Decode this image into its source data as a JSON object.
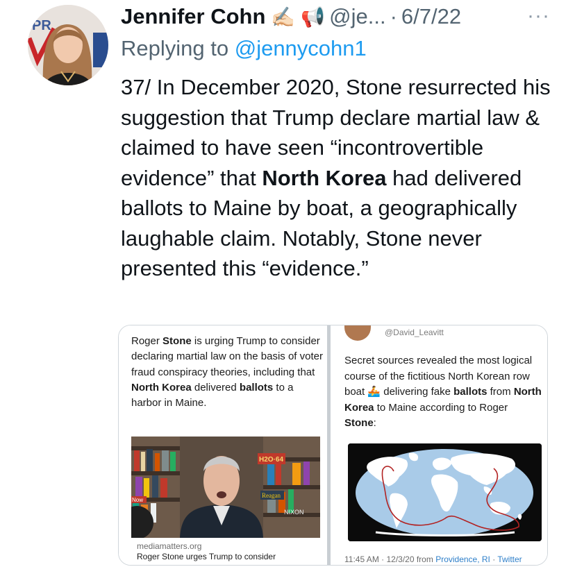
{
  "author": {
    "name": "Jennifer Cohn",
    "emoji_badges": [
      "✍🏻",
      "📢"
    ],
    "handle": "@je...",
    "separator": "·",
    "date": "6/7/22"
  },
  "more_label": "···",
  "reply": {
    "prefix": "Replying to",
    "mention": "@jennycohn1"
  },
  "tweet": {
    "before_bold": "37/ In December 2020, Stone resurrected his suggestion that Trump declare martial law & claimed to have seen “incontrovertible evidence” that ",
    "bold": "North Korea",
    "after_bold": " had delivered ballots to Maine by boat, a geographically laughable claim. Notably, Stone never presented this “evidence.”"
  },
  "media_left": {
    "p1": "Roger ",
    "b1": "Stone",
    "p2": " is urging Trump to consider declaring martial law on the basis of voter fraud conspiracy theories, including that ",
    "b2": "North Korea",
    "p3": " delivered ",
    "b3": "ballots",
    "p4": " to a harbor in Maine.",
    "video_labels": {
      "h2o": "H2O·64",
      "reagan": "Reagan",
      "nixon": "NIXON",
      "now": "Now"
    },
    "link_domain": "mediamatters.org",
    "link_title": "Roger Stone urges Trump to consider"
  },
  "media_right": {
    "handle": "@David_Leavitt",
    "p1": "Secret sources revealed the most logical course of the fictitious North Korean row boat ",
    "boat_emoji": "🚣",
    "p2": " delivering fake ",
    "b1": "ballots",
    "p3": " from ",
    "b2": "North Korea",
    "p4": " to Maine according to Roger ",
    "b3": "Stone",
    "p5": ":",
    "meta_time": "11:45 AM · 12/3/20 from ",
    "meta_location": "Providence, RI",
    "meta_sep": " · ",
    "meta_source": "Twitter"
  },
  "colors": {
    "link": "#1d9bf0",
    "secondary": "#536471",
    "route": "#b22222"
  }
}
